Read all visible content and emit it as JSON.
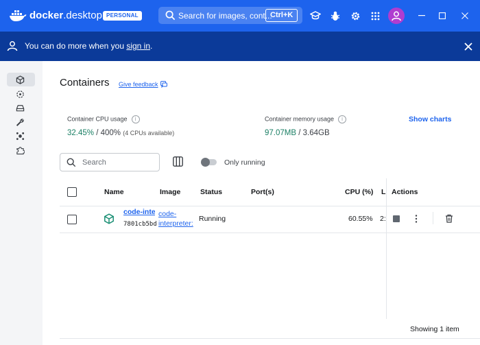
{
  "app": {
    "name_part1": "docker",
    "name_part2": ".desktop",
    "edition_badge": "PERSONAL"
  },
  "topbar": {
    "search_placeholder": "Search for images, cont...",
    "shortcut": "Ctrl+K",
    "icons": [
      "learn-icon",
      "bug-icon",
      "settings-icon",
      "extensions-grid-icon",
      "account-icon"
    ]
  },
  "banner": {
    "text_before": "You can do more when you ",
    "link": "sign in",
    "text_after": "."
  },
  "sidebar": {
    "items": [
      {
        "icon": "containers-icon",
        "active": true
      },
      {
        "icon": "images-icon",
        "active": false
      },
      {
        "icon": "volumes-icon",
        "active": false
      },
      {
        "icon": "builds-icon",
        "active": false
      },
      {
        "icon": "scout-icon",
        "active": false
      },
      {
        "icon": "extensions-icon",
        "active": false
      }
    ]
  },
  "page": {
    "title": "Containers",
    "feedback": "Give feedback"
  },
  "stats": {
    "cpu_label": "Container CPU usage",
    "cpu_value": "32.45%",
    "cpu_total": " / 400% ",
    "cpu_sub": "(4 CPUs available)",
    "mem_label": "Container memory usage",
    "mem_value": "97.07MB",
    "mem_total": " / 3.64GB",
    "show_charts": "Show charts"
  },
  "filters": {
    "search_placeholder": "Search",
    "only_running_label": "Only running",
    "only_running_on": false
  },
  "table": {
    "headers": {
      "name": "Name",
      "image": "Image",
      "status": "Status",
      "ports": "Port(s)",
      "cpu": "CPU (%)",
      "last": "L",
      "actions": "Actions"
    },
    "rows": [
      {
        "name": "code-inte",
        "id": "7801cb5bd",
        "image_line1": "code-",
        "image_line2": "interpreter:",
        "status": "Running",
        "ports": "",
        "cpu": "60.55%",
        "last": "2:"
      }
    ],
    "footer": "Showing 1 item"
  }
}
